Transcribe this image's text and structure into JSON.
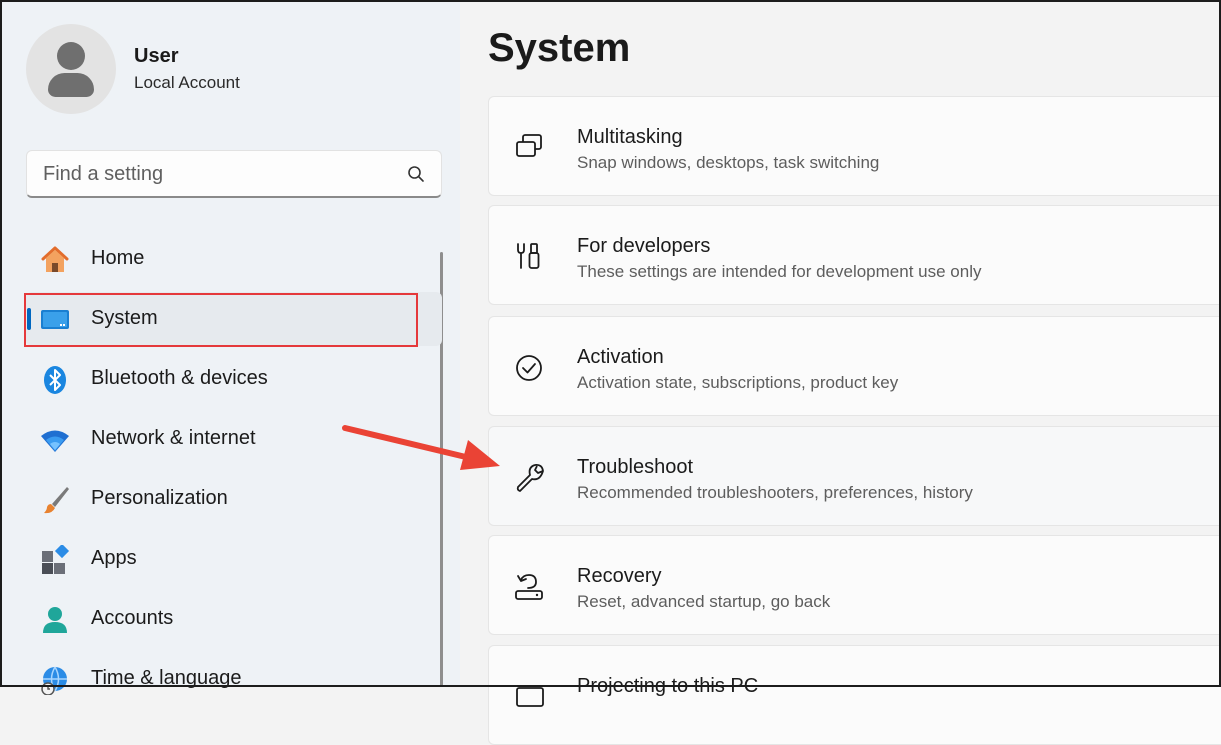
{
  "user": {
    "name": "User",
    "account_type": "Local Account"
  },
  "search": {
    "placeholder": "Find a setting"
  },
  "nav": {
    "items": [
      {
        "label": "Home",
        "icon": "home-icon"
      },
      {
        "label": "System",
        "icon": "system-monitor-icon",
        "active": true
      },
      {
        "label": "Bluetooth & devices",
        "icon": "bluetooth-icon"
      },
      {
        "label": "Network & internet",
        "icon": "wifi-icon"
      },
      {
        "label": "Personalization",
        "icon": "paint-brush-icon"
      },
      {
        "label": "Apps",
        "icon": "apps-icon"
      },
      {
        "label": "Accounts",
        "icon": "accounts-icon"
      },
      {
        "label": "Time & language",
        "icon": "globe-clock-icon"
      }
    ]
  },
  "page": {
    "title": "System",
    "cards": [
      {
        "title": "Multitasking",
        "subtitle": "Snap windows, desktops, task switching",
        "icon": "multitasking-icon"
      },
      {
        "title": "For developers",
        "subtitle": "These settings are intended for development use only",
        "icon": "developer-tools-icon"
      },
      {
        "title": "Activation",
        "subtitle": "Activation state, subscriptions, product key",
        "icon": "check-circle-icon"
      },
      {
        "title": "Troubleshoot",
        "subtitle": "Recommended troubleshooters, preferences, history",
        "icon": "wrench-icon"
      },
      {
        "title": "Recovery",
        "subtitle": "Reset, advanced startup, go back",
        "icon": "recovery-icon"
      },
      {
        "title": "Projecting to this PC",
        "subtitle": "",
        "icon": "projecting-icon"
      }
    ]
  },
  "annotations": {
    "highlight_color": "#e5393b",
    "accent_color": "#0067c0"
  }
}
